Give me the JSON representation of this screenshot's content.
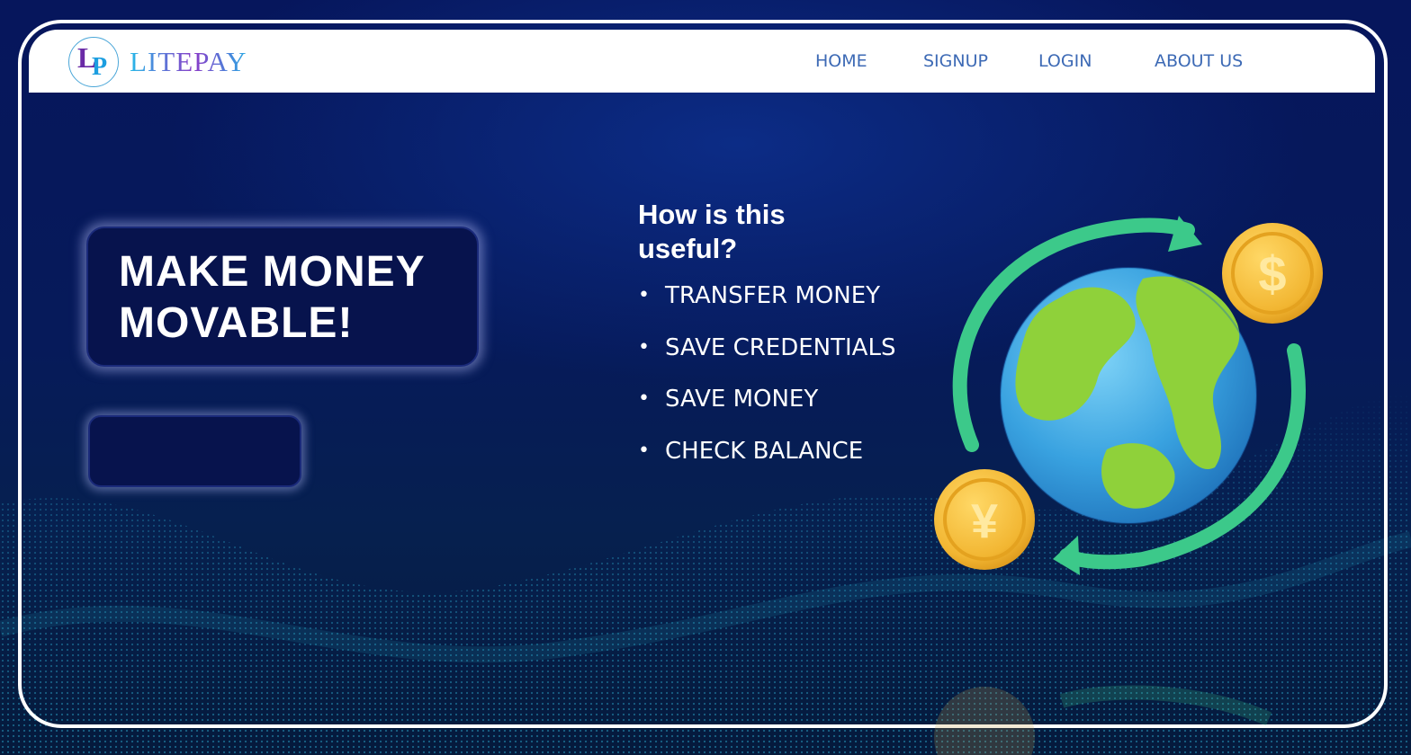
{
  "brand": {
    "logo_letter_l": "L",
    "logo_letter_p": "P",
    "name": "LITEPAY"
  },
  "nav": {
    "items": [
      {
        "label": "HOME"
      },
      {
        "label": "SIGNUP"
      },
      {
        "label": "LOGIN"
      },
      {
        "label": "ABOUT US"
      }
    ]
  },
  "hero": {
    "headline": "MAKE MONEY MOVABLE!",
    "cta_label": ""
  },
  "useful": {
    "title": "How is this useful?",
    "bullet_symbol": "•",
    "items": [
      {
        "label": "TRANSFER MONEY"
      },
      {
        "label": "SAVE CREDENTIALS"
      },
      {
        "label": "SAVE MONEY"
      },
      {
        "label": "CHECK BALANCE"
      }
    ]
  },
  "illustration": {
    "icons": [
      "globe-icon",
      "dollar-coin-icon",
      "yen-coin-icon",
      "exchange-arrows-icon"
    ],
    "coin_symbols": {
      "dollar": "$",
      "yen": "¥"
    }
  },
  "colors": {
    "background": "#06165c",
    "nav_link": "#3d6ab5",
    "frame": "#ffffff",
    "arrow": "#3cc98a",
    "coin": "#f2b632",
    "ocean": "#3aa6e0",
    "land": "#8fd13a"
  }
}
